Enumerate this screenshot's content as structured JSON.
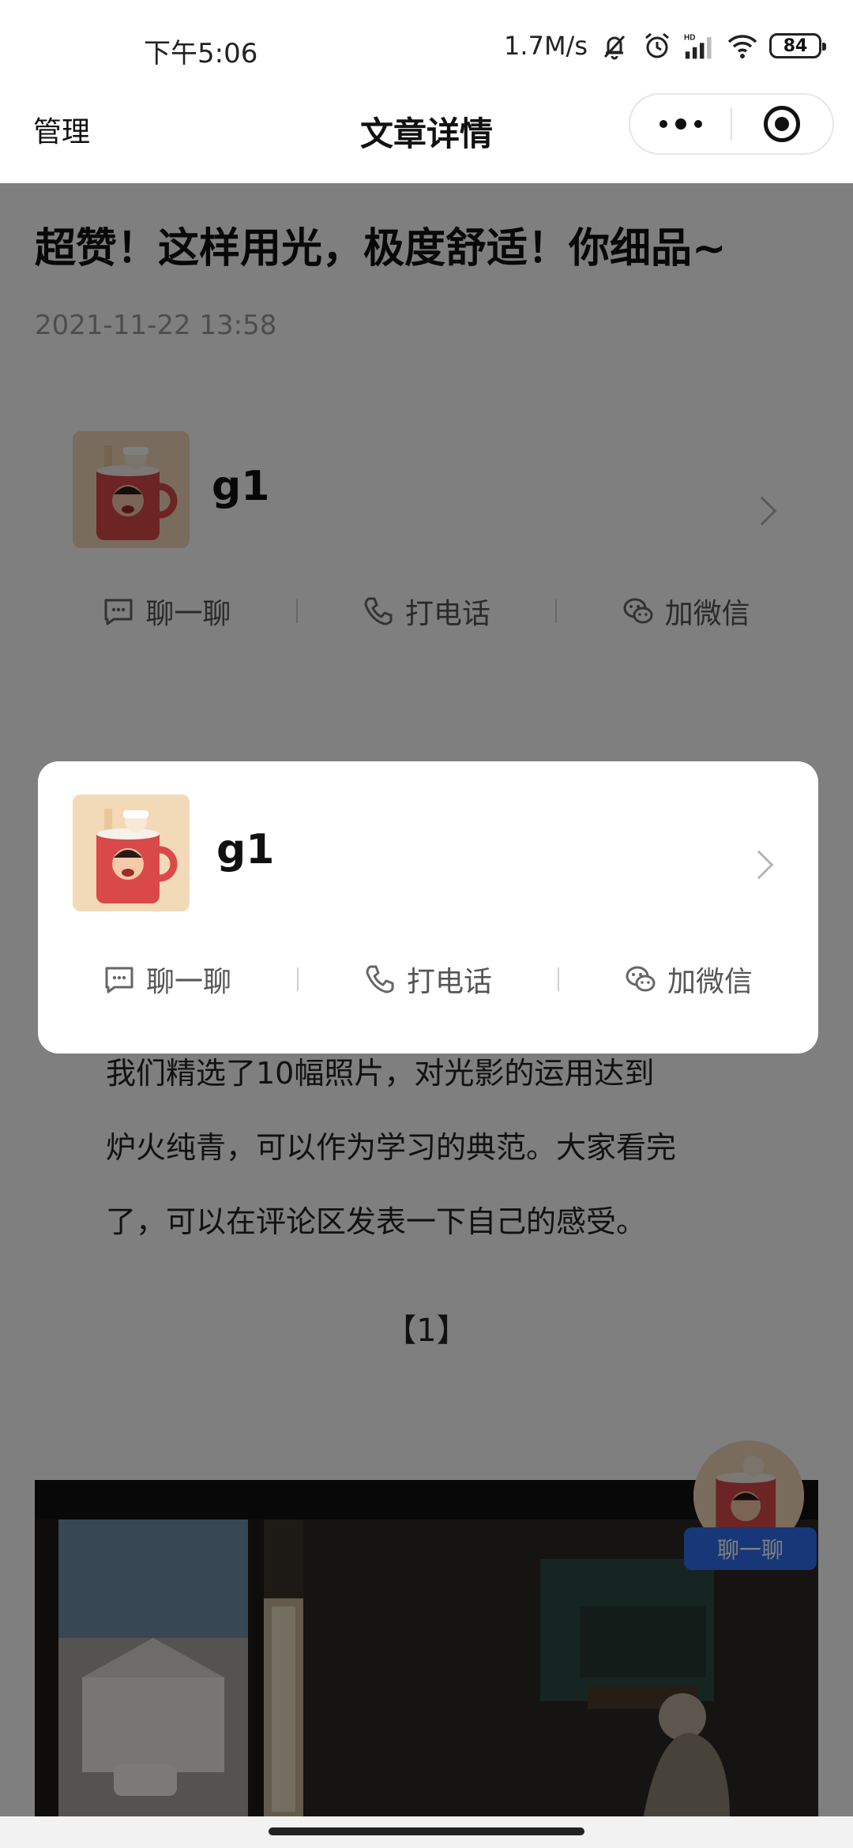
{
  "status_bar": {
    "time": "下午5:06",
    "net_speed": "1.7M/s",
    "signal_label": "HD",
    "battery": "84",
    "icons": [
      "mute-bell-icon",
      "alarm-icon",
      "signal-icon",
      "wifi-icon",
      "battery-icon"
    ]
  },
  "nav": {
    "left_label": "管理",
    "title": "文章详情",
    "capsule_icons": [
      "more-icon",
      "close-target-icon"
    ]
  },
  "article": {
    "title": "超赞！这样用光，极度舒适！你细品~",
    "date": "2021-11-22 13:58",
    "body_lines": [
      "我们精选了10幅照片，对光影的运用达到",
      "炉火纯青，可以作为学习的典范。大家看完",
      "了，可以在评论区发表一下自己的感受。"
    ],
    "section_number": "【1】"
  },
  "author_card": {
    "name": "g1",
    "actions": [
      {
        "label": "聊一聊",
        "icon": "chat-icon"
      },
      {
        "label": "打电话",
        "icon": "phone-icon"
      },
      {
        "label": "加微信",
        "icon": "wechat-icon"
      }
    ]
  },
  "popup": {
    "name": "g1",
    "actions": [
      {
        "label": "聊一聊",
        "icon": "chat-icon"
      },
      {
        "label": "打电话",
        "icon": "phone-icon"
      },
      {
        "label": "加微信",
        "icon": "wechat-icon"
      }
    ]
  },
  "float_chat": {
    "label": "聊一聊"
  },
  "colors": {
    "accent_blue": "#2f6ff0",
    "overlay": "rgba(0,0,0,0.5)",
    "muted_text": "#9a9a9a"
  }
}
